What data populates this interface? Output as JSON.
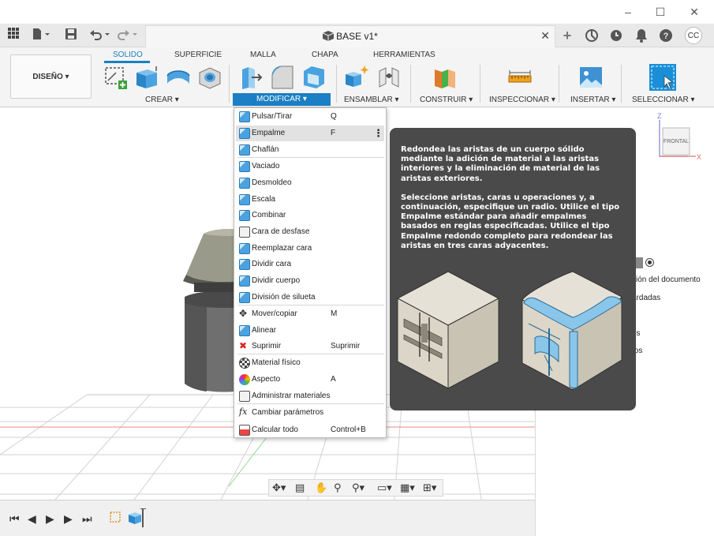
{
  "app": {
    "doc_title": "BASE v1*",
    "user_initials": "CC"
  },
  "window": {
    "minimize": "–",
    "maximize": "☐",
    "close": "✕"
  },
  "doc_tab": {
    "close": "✕",
    "new": "+"
  },
  "ribbon": {
    "workspace": "DISEÑO ▾",
    "tabs": [
      {
        "label": "SOLIDO",
        "active": true
      },
      {
        "label": "SUPERFICIE"
      },
      {
        "label": "MALLA"
      },
      {
        "label": "CHAPA"
      },
      {
        "label": "HERRAMIENTAS"
      }
    ],
    "groups": {
      "crear": "CREAR ▾",
      "modificar": "MODIFICAR ▾",
      "ensamblar": "ENSAMBLAR ▾",
      "construir": "CONSTRUIR ▾",
      "inspeccionar": "INSPECCIONAR ▾",
      "insertar": "INSERTAR ▾",
      "seleccionar": "SELECCIONAR ▾"
    }
  },
  "viewcube": {
    "face": "FRONTAL",
    "axis_z": "Z",
    "axis_x": "X"
  },
  "menu": {
    "items": [
      {
        "label": "Pulsar/Tirar",
        "shortcut": "Q",
        "icon": "press-pull-icon"
      },
      {
        "label": "Empalme",
        "shortcut": "F",
        "icon": "fillet-icon",
        "highlighted": true
      },
      {
        "label": "Chaflán",
        "shortcut": "",
        "icon": "chamfer-icon"
      },
      {
        "label": "Vaciado",
        "shortcut": "",
        "icon": "shell-icon"
      },
      {
        "label": "Desmoldeo",
        "shortcut": "",
        "icon": "draft-icon"
      },
      {
        "label": "Escala",
        "shortcut": "",
        "icon": "scale-icon"
      },
      {
        "label": "Combinar",
        "shortcut": "",
        "icon": "combine-icon"
      },
      {
        "label": "Cara de desfase",
        "shortcut": "",
        "icon": "offset-face-icon"
      },
      {
        "label": "Reemplazar cara",
        "shortcut": "",
        "icon": "replace-face-icon"
      },
      {
        "label": "Dividir cara",
        "shortcut": "",
        "icon": "split-face-icon"
      },
      {
        "label": "Dividir cuerpo",
        "shortcut": "",
        "icon": "split-body-icon"
      },
      {
        "label": "División de silueta",
        "shortcut": "",
        "icon": "silhouette-split-icon"
      },
      {
        "label": "Mover/copiar",
        "shortcut": "M",
        "icon": "move-icon"
      },
      {
        "label": "Alinear",
        "shortcut": "",
        "icon": "align-icon"
      },
      {
        "label": "Suprimir",
        "shortcut": "Suprimir",
        "icon": "delete-icon"
      },
      {
        "label": "Material físico",
        "shortcut": "",
        "icon": "physical-material-icon"
      },
      {
        "label": "Aspecto",
        "shortcut": "A",
        "icon": "appearance-icon"
      },
      {
        "label": "Administrar materiales",
        "shortcut": "",
        "icon": "manage-materials-icon"
      },
      {
        "label": "Cambiar parámetros",
        "shortcut": "",
        "icon": "parameters-icon"
      },
      {
        "label": "Calcular todo",
        "shortcut": "Control+B",
        "icon": "compute-all-icon"
      }
    ]
  },
  "tooltip": {
    "para1": "Redondea las aristas de un cuerpo sólido mediante la adición de material a las aristas interiores y la eliminación de material de las aristas exteriores.",
    "para2": "Seleccione aristas, caras u operaciones y, a continuación, especifique un radio. Utilice el tipo Empalme estándar para añadir empalmes basados en reglas especificadas. Utilice el tipo Empalme redondo completo para redondear las aristas en tres caras adyacentes."
  },
  "right_panel": {
    "items": [
      "ción del documento",
      "ardadas",
      "n",
      "os",
      "tos"
    ]
  },
  "colors": {
    "accent": "#1a7fc4",
    "tooltip_bg": "#4a4a4a",
    "fillet_blue": "#8ac6ea"
  }
}
